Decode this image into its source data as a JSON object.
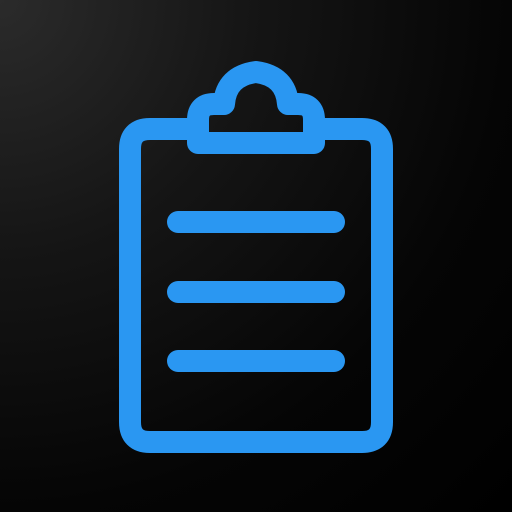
{
  "icon": {
    "name": "clipboard-icon",
    "description_lines": 3
  },
  "colors": {
    "accent": "#2A97F2",
    "background": "#000000",
    "background_highlight": "#2B2B2B"
  }
}
